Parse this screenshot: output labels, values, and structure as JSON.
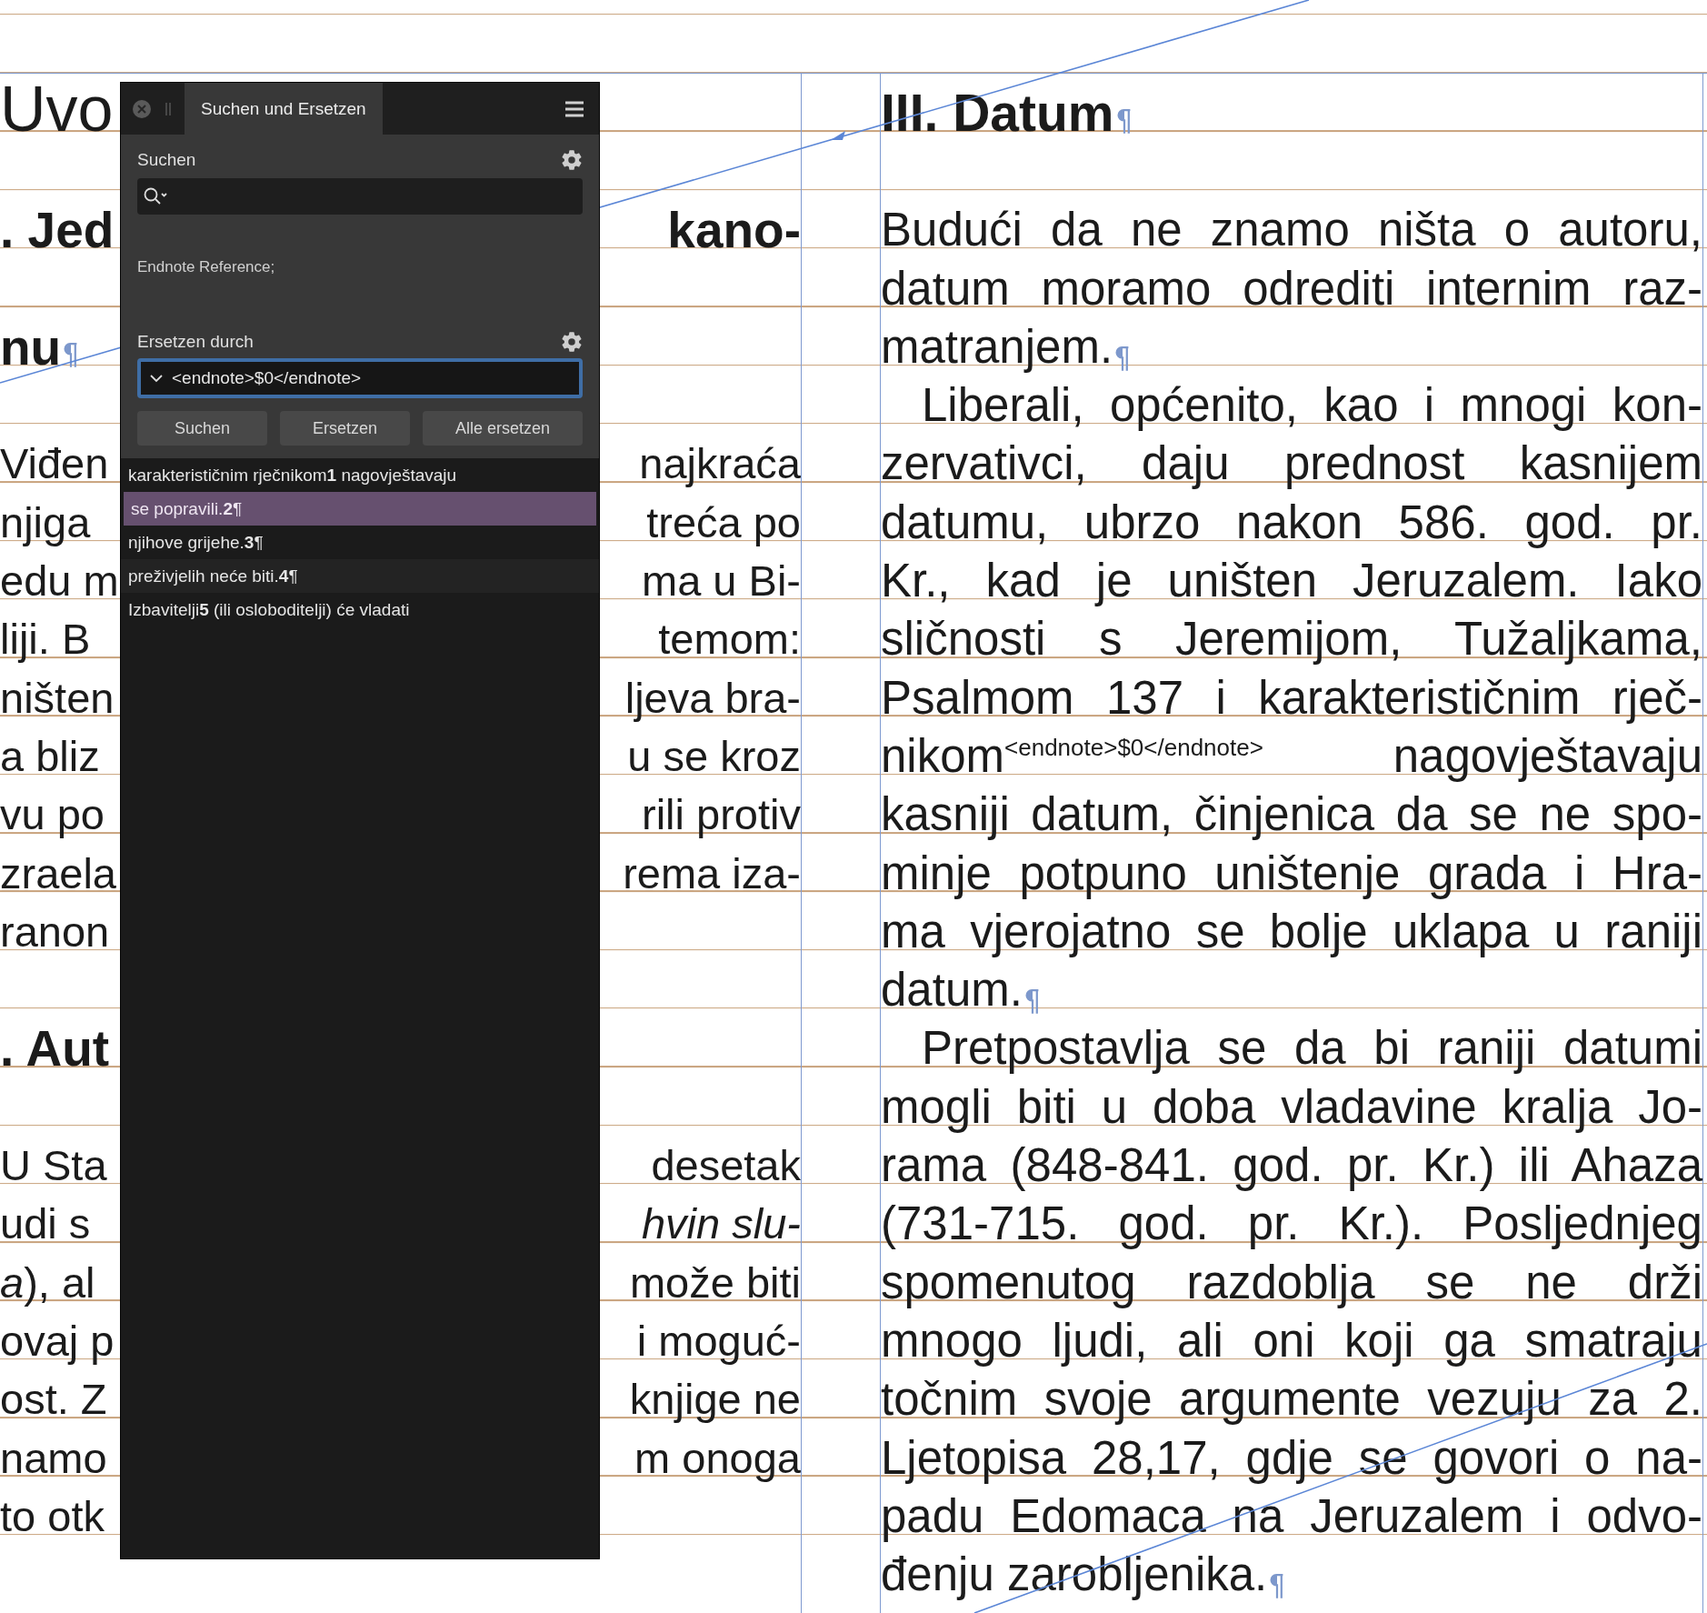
{
  "panel": {
    "title": "Suchen und Ersetzen",
    "find_label": "Suchen",
    "find_format": "Endnote Reference;",
    "replace_label": "Ersetzen durch",
    "replace_value": "<endnote>$0</endnote>",
    "buttons": [
      "Suchen",
      "Ersetzen",
      "Alle ersetzen"
    ],
    "results": [
      {
        "text": "karakterističnim rječnikom**1** nagovještavaju",
        "selected": false
      },
      {
        "text": "se popravili.**2**¶",
        "selected": true
      },
      {
        "text": "njihove grijehe.**3**¶",
        "selected": false
      },
      {
        "text": "preživjelih neće biti.**4**¶",
        "selected": false
      },
      {
        "text": "Izbavitelji**5** (ili osloboditelji) će vladati",
        "selected": false
      }
    ]
  },
  "left_column": {
    "blocks": [
      {
        "kind": "title",
        "lines": [
          {
            "left": "Uvo"
          }
        ]
      },
      {
        "kind": "heading",
        "lines": [
          {
            "left": ". Jed",
            "right": "kano-"
          },
          {
            "left": "nu",
            "pilcrow": true
          }
        ]
      },
      {
        "kind": "paragraph",
        "lines": [
          {
            "left": "Viđen",
            "right": "najkraća"
          },
          {
            "left": "njiga",
            "right": "treća po"
          },
          {
            "left": "edu m",
            "right": "ma u Bi-"
          },
          {
            "left": "liji. B",
            "right": "temom:"
          },
          {
            "left": "ništen",
            "right": "ljeva bra-"
          },
          {
            "left": "a bliz",
            "right": "u se kroz"
          },
          {
            "left": "vu po",
            "right": "rili protiv"
          },
          {
            "left": "zraela",
            "right": "rema iza-"
          },
          {
            "left": "ranon"
          }
        ]
      },
      {
        "kind": "heading",
        "lines": [
          {
            "left": ". Aut"
          }
        ]
      },
      {
        "kind": "paragraph",
        "lines": [
          {
            "left": "U Sta",
            "right": "desetak"
          },
          {
            "left": "udi s",
            "right": "hvin slu-",
            "right_italic": true
          },
          {
            "left": "*a*), al",
            "right": "može biti"
          },
          {
            "left": "ovaj p",
            "right": "i moguć-"
          },
          {
            "left": "ost. Z",
            "right": "knjige ne"
          },
          {
            "left": "namo",
            "right": "m onoga"
          },
          {
            "left": "to otk"
          }
        ]
      }
    ]
  },
  "right_column": {
    "blocks": [
      {
        "kind": "heading",
        "lines": [
          {
            "text": "III. Datum",
            "pilcrow": true
          }
        ]
      },
      {
        "kind": "paragraph",
        "indent": false,
        "pilcrow": true,
        "lines": [
          {
            "text": "Budući da ne znamo ništa o autoru,"
          },
          {
            "text": "datum moramo odrediti internim raz-"
          },
          {
            "text": "matranjem."
          }
        ]
      },
      {
        "kind": "paragraph",
        "indent": true,
        "pilcrow": true,
        "lines": [
          {
            "text": "Liberali, općenito, kao i mnogi kon-"
          },
          {
            "text": "zervativci, daju prednost kasnijem"
          },
          {
            "text": "datumu, ubrzo nakon 586. god. pr."
          },
          {
            "text": "Kr., kad je uništen Jeruzalem. Iako"
          },
          {
            "text": "sličnosti s Jeremijom, Tužaljkama,"
          },
          {
            "text": "Psalmom 137 i karakterističnim rječ-"
          },
          {
            "text": "nikom",
            "superscript": "<endnote>$0</endnote>",
            "after": "nagovještavaju"
          },
          {
            "text": "kasniji datum, činjenica da se ne spo-"
          },
          {
            "text": "minje potpuno uništenje grada i Hra-"
          },
          {
            "text": "ma vjerojatno se bolje uklapa u raniji"
          },
          {
            "text": "datum."
          }
        ]
      },
      {
        "kind": "paragraph",
        "indent": true,
        "pilcrow": true,
        "lines": [
          {
            "text": "Pretpostavlja se da bi raniji datumi"
          },
          {
            "text": "mogli biti u doba vladavine kralja Jo-"
          },
          {
            "text": "rama (848-841. god. pr. Kr.) ili Ahaza"
          },
          {
            "text": "(731-715. god. pr. Kr.). Posljednjeg"
          },
          {
            "text": "spomenutog razdoblja se ne drži"
          },
          {
            "text": "mnogo ljudi, ali oni koji ga smatraju"
          },
          {
            "text": "točnim svoje argumente vezuju za 2."
          },
          {
            "text": "Ljetopisa 28,17, gdje se govori o na-"
          },
          {
            "text": "padu Edomaca na Jeruzalem i odvo-"
          },
          {
            "text": "đenju zarobljenika."
          }
        ]
      }
    ]
  }
}
